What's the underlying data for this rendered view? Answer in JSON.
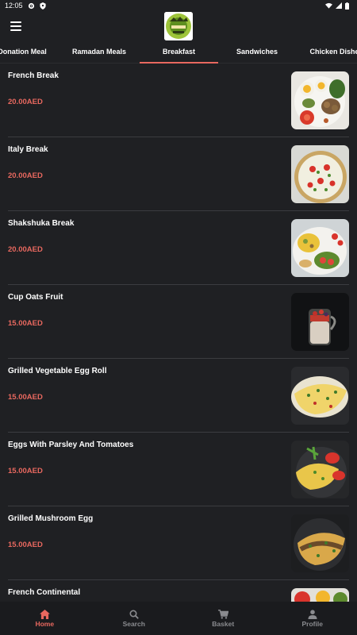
{
  "status_bar": {
    "time": "12:05"
  },
  "header": {
    "logo_name": "restaurant-logo"
  },
  "tabs": [
    {
      "label": "Donation Meal",
      "active": false
    },
    {
      "label": "Ramadan Meals",
      "active": false
    },
    {
      "label": "Breakfast",
      "active": true
    },
    {
      "label": "Sandwiches",
      "active": false
    },
    {
      "label": "Chicken Dishes",
      "active": false
    }
  ],
  "menu_items": [
    {
      "name": "French Break",
      "price": "20.00AED"
    },
    {
      "name": "Italy Break",
      "price": "20.00AED"
    },
    {
      "name": "Shakshuka Break",
      "price": "20.00AED"
    },
    {
      "name": "Cup Oats Fruit",
      "price": "15.00AED"
    },
    {
      "name": "Grilled Vegetable Egg Roll",
      "price": "15.00AED"
    },
    {
      "name": "Eggs With Parsley And Tomatoes",
      "price": "15.00AED"
    },
    {
      "name": "Grilled Mushroom Egg",
      "price": "15.00AED"
    },
    {
      "name": "French Continental",
      "price": ""
    }
  ],
  "bottom_nav": [
    {
      "label": "Home",
      "icon": "home-icon",
      "active": true
    },
    {
      "label": "Search",
      "icon": "search-icon",
      "active": false
    },
    {
      "label": "Basket",
      "icon": "cart-icon",
      "active": false
    },
    {
      "label": "Profile",
      "icon": "profile-icon",
      "active": false
    }
  ],
  "colors": {
    "accent": "#e8685f",
    "background": "#1f2023",
    "nav_background": "#1a1b1e"
  }
}
